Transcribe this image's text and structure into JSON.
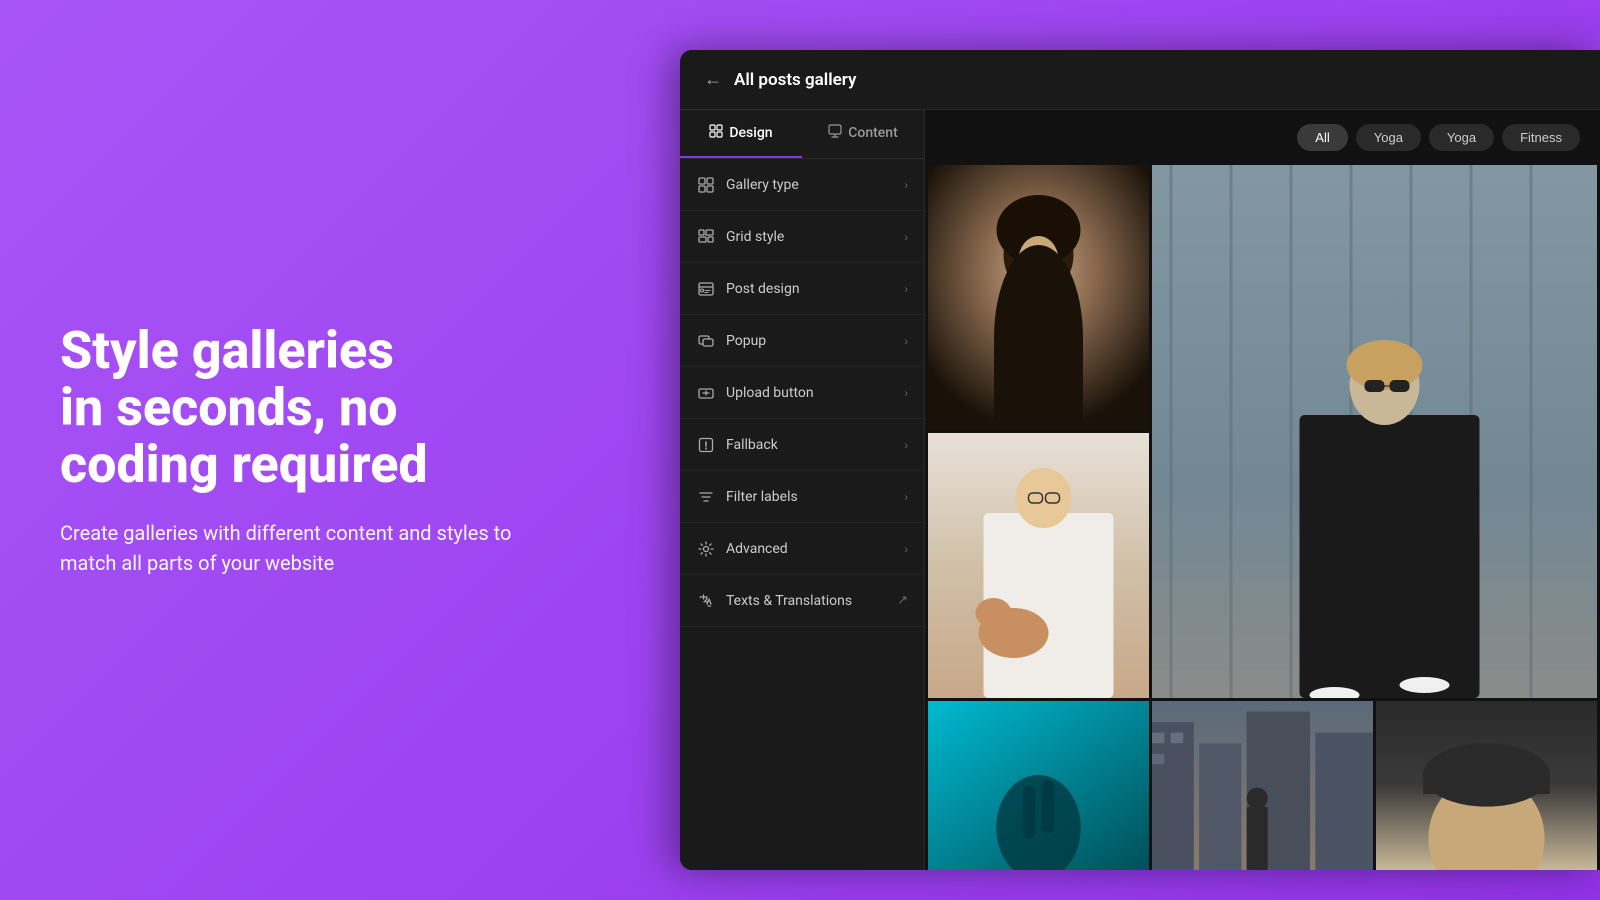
{
  "background": {
    "color": "#a855f7"
  },
  "hero": {
    "heading": "Style galleries\nin seconds, no\ncoding required",
    "subtext": "Create galleries with different content and styles to match all parts of your website"
  },
  "app": {
    "title": "All posts gallery",
    "back_label": "←",
    "tabs": [
      {
        "id": "design",
        "label": "Design",
        "active": true
      },
      {
        "id": "content",
        "label": "Content",
        "active": false
      }
    ],
    "menu_items": [
      {
        "id": "gallery-type",
        "label": "Gallery type",
        "icon": "grid-icon",
        "has_arrow": true
      },
      {
        "id": "grid-style",
        "label": "Grid style",
        "icon": "grid2-icon",
        "has_arrow": true
      },
      {
        "id": "post-design",
        "label": "Post design",
        "icon": "image-icon",
        "has_arrow": true
      },
      {
        "id": "popup",
        "label": "Popup",
        "icon": "popup-icon",
        "has_arrow": true
      },
      {
        "id": "upload-button",
        "label": "Upload button",
        "icon": "upload-icon",
        "has_arrow": true
      },
      {
        "id": "fallback",
        "label": "Fallback",
        "icon": "fallback-icon",
        "has_arrow": true
      },
      {
        "id": "filter-labels",
        "label": "Filter labels",
        "icon": "filter-icon",
        "has_arrow": true
      },
      {
        "id": "advanced",
        "label": "Advanced",
        "icon": "gear-icon",
        "has_arrow": true
      },
      {
        "id": "texts-translations",
        "label": "Texts & Translations",
        "icon": "text-icon",
        "has_arrow": false,
        "has_external": true
      }
    ],
    "filter_buttons": [
      {
        "id": "all",
        "label": "All",
        "active": true
      },
      {
        "id": "yoga1",
        "label": "Yoga",
        "active": false
      },
      {
        "id": "yoga2",
        "label": "Yoga",
        "active": false
      },
      {
        "id": "fitness",
        "label": "Fitness",
        "active": false
      }
    ]
  }
}
